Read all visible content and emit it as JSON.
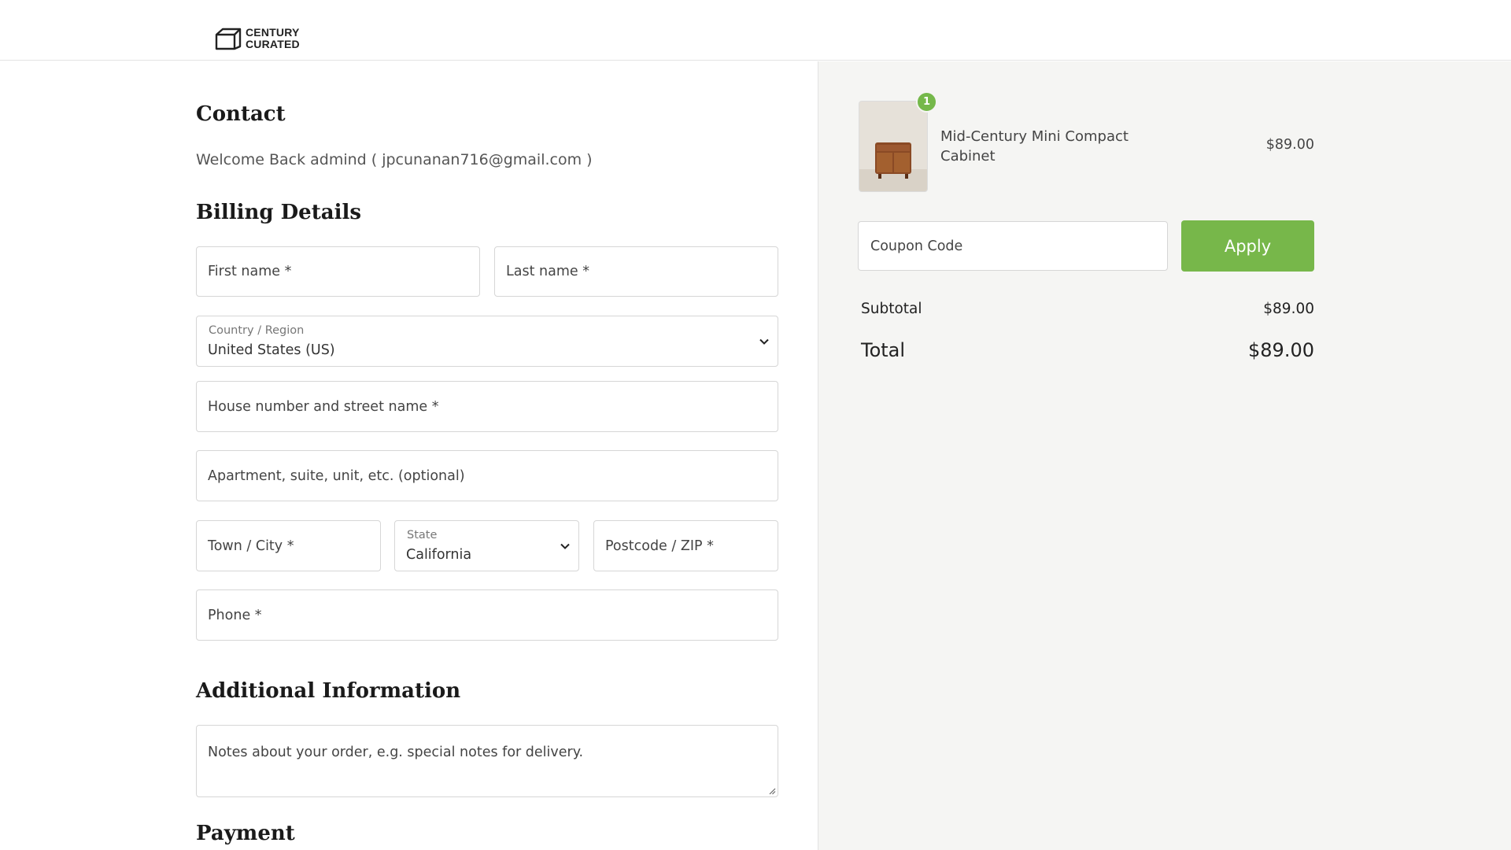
{
  "brand": {
    "line1": "CENTURY",
    "line2": "CURATED"
  },
  "contact": {
    "title": "Contact",
    "welcome": "Welcome Back admind ( jpcunanan716@gmail.com )"
  },
  "billing": {
    "title": "Billing Details",
    "first_name_placeholder": "First name *",
    "last_name_placeholder": "Last name *",
    "country_label": "Country / Region",
    "country_value": "United States (US)",
    "street_placeholder": "House number and street name *",
    "apartment_placeholder": "Apartment, suite, unit, etc. (optional)",
    "city_placeholder": "Town / City *",
    "state_label": "State",
    "state_value": "California",
    "zip_placeholder": "Postcode / ZIP *",
    "phone_placeholder": "Phone *"
  },
  "additional": {
    "title": "Additional Information",
    "notes_placeholder": "Notes about your order, e.g. special notes for delivery."
  },
  "payment": {
    "title": "Payment"
  },
  "summary": {
    "item": {
      "quantity": "1",
      "name": "Mid-Century Mini Compact Cabinet",
      "price": "$89.00"
    },
    "coupon_placeholder": "Coupon Code",
    "apply_label": "Apply",
    "subtotal_label": "Subtotal",
    "subtotal_value": "$89.00",
    "total_label": "Total",
    "total_value": "$89.00"
  },
  "colors": {
    "accent": "#77b74a",
    "summary_bg": "#f5f5f3"
  },
  "icons": [
    "logo-box-icon",
    "chevron-down-icon",
    "resize-grip-icon"
  ]
}
